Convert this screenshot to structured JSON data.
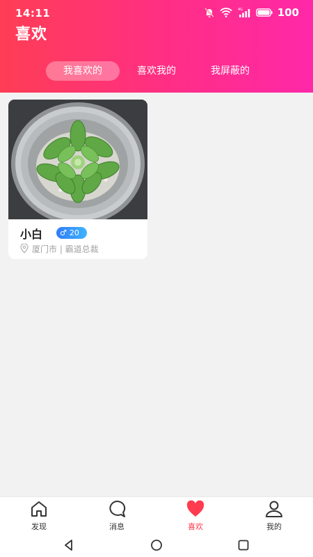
{
  "status_bar": {
    "time": "14:11",
    "network": "4G",
    "battery": "100"
  },
  "header": {
    "title": "喜欢"
  },
  "tabs": [
    {
      "label": "我喜欢的",
      "active": true
    },
    {
      "label": "喜欢我的",
      "active": false
    },
    {
      "label": "我屏蔽的",
      "active": false
    }
  ],
  "cards": [
    {
      "name": "小白",
      "gender_icon": "male-symbol",
      "gender_symbol": "♂",
      "age": "20",
      "location": "厦门市 | 霸道总裁"
    }
  ],
  "bottom_nav": [
    {
      "label": "发现",
      "icon": "home-icon",
      "active": false
    },
    {
      "label": "消息",
      "icon": "chat-bubble-icon",
      "active": false
    },
    {
      "label": "喜欢",
      "icon": "heart-icon",
      "active": true
    },
    {
      "label": "我的",
      "icon": "person-icon",
      "active": false
    }
  ],
  "colors": {
    "header_gradient_start": "#ff3d55",
    "header_gradient_end": "#ff28a8",
    "active_accent": "#ff3b4f",
    "badge_blue": "#2f7cf6"
  }
}
